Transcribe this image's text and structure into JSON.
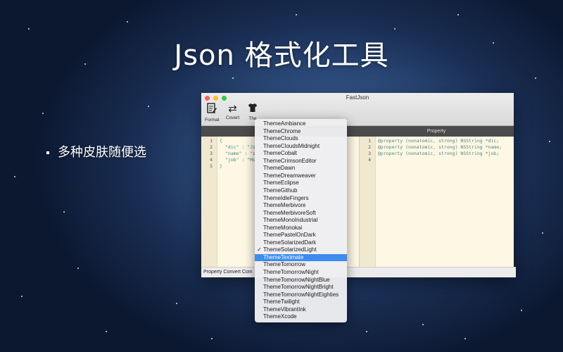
{
  "headline": "Json 格式化工具",
  "bullet_text": "多种皮肤随便选",
  "window": {
    "title": "FastJson",
    "toolbar": {
      "format_label": "Format",
      "covert_label": "Covert",
      "theme_label": "The"
    },
    "property_header": "Property",
    "json_lines": [
      {
        "num": "1",
        "text": "{"
      },
      {
        "num": "2",
        "text": "\"dic\" : \"Js"
      },
      {
        "num": "3",
        "text": "\"name\" : \"s"
      },
      {
        "num": "4",
        "text": "\"job\" : \"Mo"
      },
      {
        "num": "5",
        "text": "}"
      }
    ],
    "property_lines": [
      {
        "num": "1",
        "text": "@property (nonatomic, strong) NSString *dic;"
      },
      {
        "num": "2",
        "text": "@property (nonatomic, strong) NSString *name;"
      },
      {
        "num": "3",
        "text": "@property (nonatomic, strong) NSString *job;"
      },
      {
        "num": "4",
        "text": ""
      }
    ],
    "status_text": "Property Convert Com"
  },
  "theme_menu": {
    "items": [
      "ThemeAmbiance",
      "ThemeChrome",
      "ThemeClouds",
      "ThemeCloudsMidnight",
      "ThemeCobalt",
      "ThemeCrimsonEditor",
      "ThemeDawn",
      "ThemeDreamweaver",
      "ThemeEclipse",
      "ThemeGithub",
      "ThemeIdleFingers",
      "ThemeMerbivore",
      "ThemeMerbivoreSoft",
      "ThemeMonoIndustrial",
      "ThemeMonokai",
      "ThemePastelOnDark",
      "ThemeSolarizedDark",
      "ThemeSolarizedLight",
      "ThemeTextmate",
      "ThemeTomorrow",
      "ThemeTomorrowNight",
      "ThemeTomorrowNightBlue",
      "ThemeTomorrowNightBright",
      "ThemeTomorrowNightEighties",
      "ThemeTwilight",
      "ThemeVibrantInk",
      "ThemeXcode"
    ],
    "checked": "ThemeSolarizedLight",
    "highlighted": "ThemeTextmate",
    "check_glyph": "✓"
  },
  "colors": {
    "menu_highlight": "#3d8cf0",
    "editor_bg": "#fdf7e3",
    "header_bar": "#4b4b4b"
  },
  "icons": [
    "format-icon",
    "convert-arrows-icon",
    "tshirt-theme-icon"
  ]
}
